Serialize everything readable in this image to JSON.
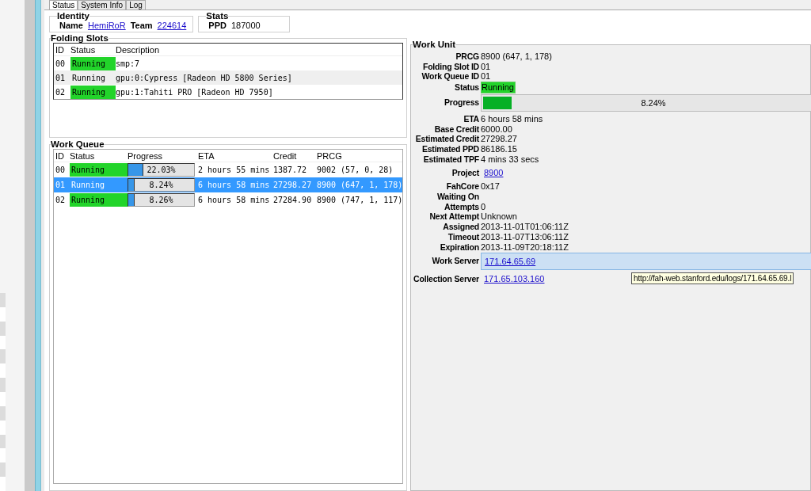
{
  "tabs": [
    {
      "label": "Status",
      "selected": true
    },
    {
      "label": "System Info",
      "selected": false
    },
    {
      "label": "Log",
      "selected": false
    }
  ],
  "identity": {
    "title": "Identity",
    "name_label": "Name",
    "name": "HemiRoR",
    "team_label": "Team",
    "team": "224614"
  },
  "stats": {
    "title": "Stats",
    "ppd_label": "PPD",
    "ppd": "187000"
  },
  "folding_slots": {
    "title": "Folding Slots",
    "columns": [
      "ID",
      "Status",
      "Description"
    ],
    "rows": [
      {
        "id": "00",
        "status": "Running",
        "highlighted": true,
        "description": "smp:7"
      },
      {
        "id": "01",
        "status": "Running",
        "highlighted": false,
        "description": "gpu:0:Cypress [Radeon HD 5800 Series]"
      },
      {
        "id": "02",
        "status": "Running",
        "highlighted": true,
        "description": "gpu:1:Tahiti PRO [Radeon HD 7950]"
      }
    ]
  },
  "work_queue": {
    "title": "Work Queue",
    "columns": [
      "ID",
      "Status",
      "Progress",
      "ETA",
      "Credit",
      "PRCG"
    ],
    "rows": [
      {
        "id": "00",
        "status": "Running",
        "highlighted": true,
        "level": 0.2203,
        "progress": "22.03%",
        "eta": "2 hours 55 mins",
        "credit": "1387.72",
        "prcg": "9002 (57, 0, 28)",
        "selected": false
      },
      {
        "id": "01",
        "status": "Running",
        "highlighted": false,
        "level": 0.0824,
        "progress": "8.24%",
        "eta": "6 hours 58 mins",
        "credit": "27298.27",
        "prcg": "8900 (647, 1, 178)",
        "selected": true
      },
      {
        "id": "02",
        "status": "Running",
        "highlighted": true,
        "level": 0.0826,
        "progress": "8.26%",
        "eta": "6 hours 58 mins",
        "credit": "27284.90",
        "prcg": "8900 (747, 1, 117)",
        "selected": false
      }
    ]
  },
  "work_unit": {
    "title": "Work Unit",
    "fields": [
      {
        "kind": "text",
        "label": "PRCG",
        "value": "8900 (647, 1, 178)"
      },
      {
        "kind": "text",
        "label": "Folding Slot ID",
        "value": "01"
      },
      {
        "kind": "text",
        "label": "Work Queue ID",
        "value": "01"
      },
      {
        "kind": "status",
        "label": "Status",
        "value": "Running"
      },
      {
        "kind": "progress",
        "label": "Progress",
        "level": 0.0824,
        "value": "8.24%"
      },
      {
        "kind": "text",
        "label": "ETA",
        "value": "6 hours 58 mins"
      },
      {
        "kind": "text",
        "label": "Base Credit",
        "value": "6000.00"
      },
      {
        "kind": "text",
        "label": "Estimated Credit",
        "value": "27298.27"
      },
      {
        "kind": "text",
        "label": "Estimated PPD",
        "value": "86186.15"
      },
      {
        "kind": "text",
        "label": "Estimated TPF",
        "value": "4 mins 33 secs"
      },
      {
        "kind": "link",
        "label": "Project",
        "value": "8900"
      },
      {
        "kind": "text",
        "label": "FahCore",
        "value": "0x17"
      },
      {
        "kind": "text",
        "label": "Waiting On"
      },
      {
        "kind": "text",
        "label": "Attempts",
        "value": "0"
      },
      {
        "kind": "text",
        "label": "Next Attempt",
        "value": "Unknown"
      },
      {
        "kind": "text",
        "label": "Assigned",
        "value": "2013-11-01T01:06:11Z"
      },
      {
        "kind": "text",
        "label": "Timeout",
        "value": "2013-11-07T13:06:11Z"
      },
      {
        "kind": "text",
        "label": "Expiration",
        "value": "2013-11-09T20:18:11Z"
      },
      {
        "kind": "field",
        "label": "Work Server",
        "value": "171.64.65.69"
      },
      {
        "kind": "link",
        "label": "Collection Server",
        "value": "171.65.103.160"
      }
    ]
  },
  "tooltip": "http://fah-web.stanford.edu/logs/171.64.65.69.l"
}
